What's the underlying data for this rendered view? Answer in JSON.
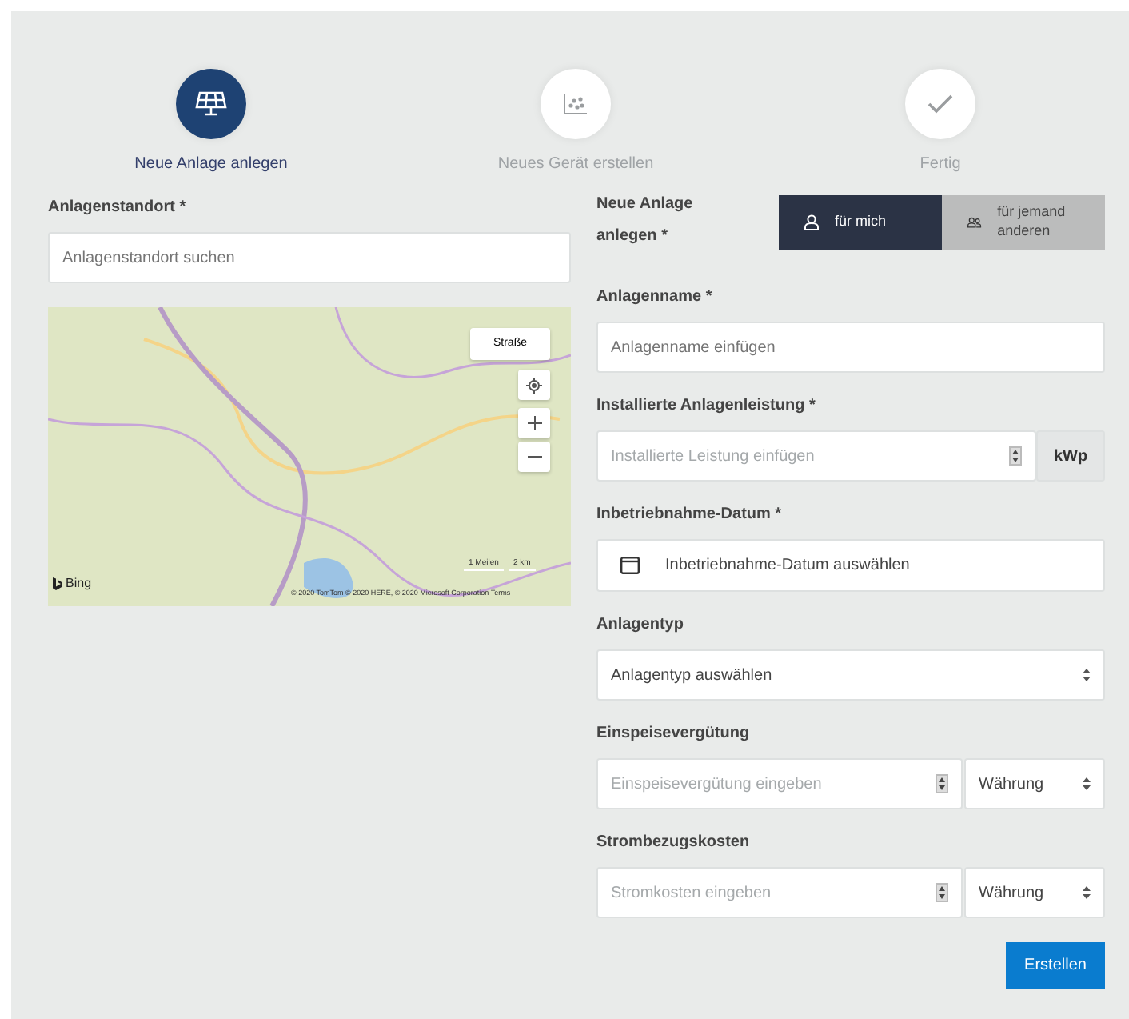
{
  "steps": [
    {
      "label": "Neue Anlage anlegen",
      "selected": true
    },
    {
      "label": "Neues Gerät erstellen",
      "selected": false
    },
    {
      "label": "Fertig",
      "selected": false
    }
  ],
  "location": {
    "label": "Anlagenstandort *",
    "placeholder": "Anlagenstandort suchen",
    "map": {
      "style_button": "Straße",
      "logo": "Bing",
      "scale": [
        "1 Meilen",
        "2 km"
      ],
      "attribution": "© 2020 TomTom © 2020 HERE, © 2020 Microsoft Corporation Terms"
    }
  },
  "fields": [
    {
      "kind": "toggle",
      "label": "Neue Anlage anlegen *",
      "options": [
        {
          "label": "für mich",
          "selected": true
        },
        {
          "label": "für jemand anderen",
          "selected": false
        }
      ]
    },
    {
      "kind": "text",
      "label": "Anlagenname *",
      "placeholder": "Anlagenname einfügen"
    },
    {
      "kind": "number-unit",
      "label": "Installierte Anlagenleistung *",
      "placeholder": "Installierte Leistung einfügen",
      "unit": "kWp"
    },
    {
      "kind": "date",
      "label": "Inbetriebnahme-Datum *",
      "placeholder": "Inbetriebnahme-Datum auswählen"
    },
    {
      "kind": "select",
      "label": "Anlagentyp",
      "value": "Anlagentyp auswählen"
    },
    {
      "kind": "number-currency",
      "label": "Einspeisevergütung",
      "placeholder": "Einspeisevergütung eingeben",
      "currency": "Währung"
    },
    {
      "kind": "number-currency",
      "label": "Strombezugskosten",
      "placeholder": "Stromkosten eingeben",
      "currency": "Währung"
    }
  ],
  "submit": "Erstellen"
}
